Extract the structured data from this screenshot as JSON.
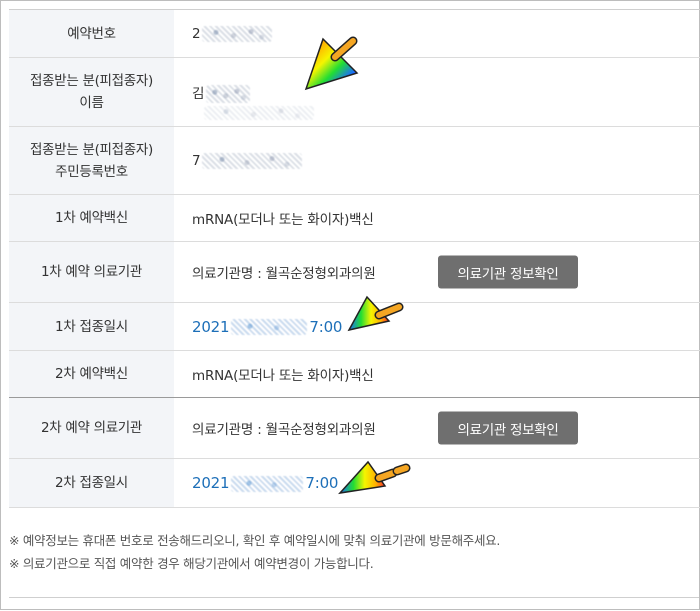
{
  "rows": [
    {
      "label": "예약번호",
      "value_prefix": "2"
    },
    {
      "label_line1": "접종받는 분(피접종자)",
      "label_line2": "이름",
      "value_prefix": "김"
    },
    {
      "label_line1": "접종받는 분(피접종자)",
      "label_line2": "주민등록번호",
      "value_prefix": "7"
    },
    {
      "label": "1차 예약백신",
      "value": "mRNA(모더나 또는 화이자)백신"
    },
    {
      "label": "1차 예약 의료기관",
      "value": "의료기관명 : 월곡순정형외과의원",
      "button": "의료기관 정보확인"
    },
    {
      "label": "1차 접종일시",
      "date_prefix": "2021",
      "date_suffix": "7:00"
    },
    {
      "label": "2차 예약백신",
      "value": "mRNA(모더나 또는 화이자)백신"
    },
    {
      "label": "2차 예약 의료기관",
      "value": "의료기관명 : 월곡순정형외과의원",
      "button": "의료기관 정보확인"
    },
    {
      "label": "2차 접종일시",
      "date_prefix": "2021",
      "date_suffix": "7:00"
    }
  ],
  "notes": [
    "※ 예약정보는 휴대폰 번호로 전송해드리오니, 확인 후 예약일시에 맞춰 의료기관에 방문해주세요.",
    "※ 의료기관으로 직접 예약한 경우 해당기관에서 예약변경이 가능합니다."
  ],
  "colors": {
    "label_bg": "#f3f5f8",
    "date_text": "#1d6fb8",
    "button_bg": "#6f6f6f"
  },
  "annotations": [
    "rainbow-pointer-arrow",
    "rainbow-pointer-arrow",
    "rainbow-pointer-arrow"
  ]
}
